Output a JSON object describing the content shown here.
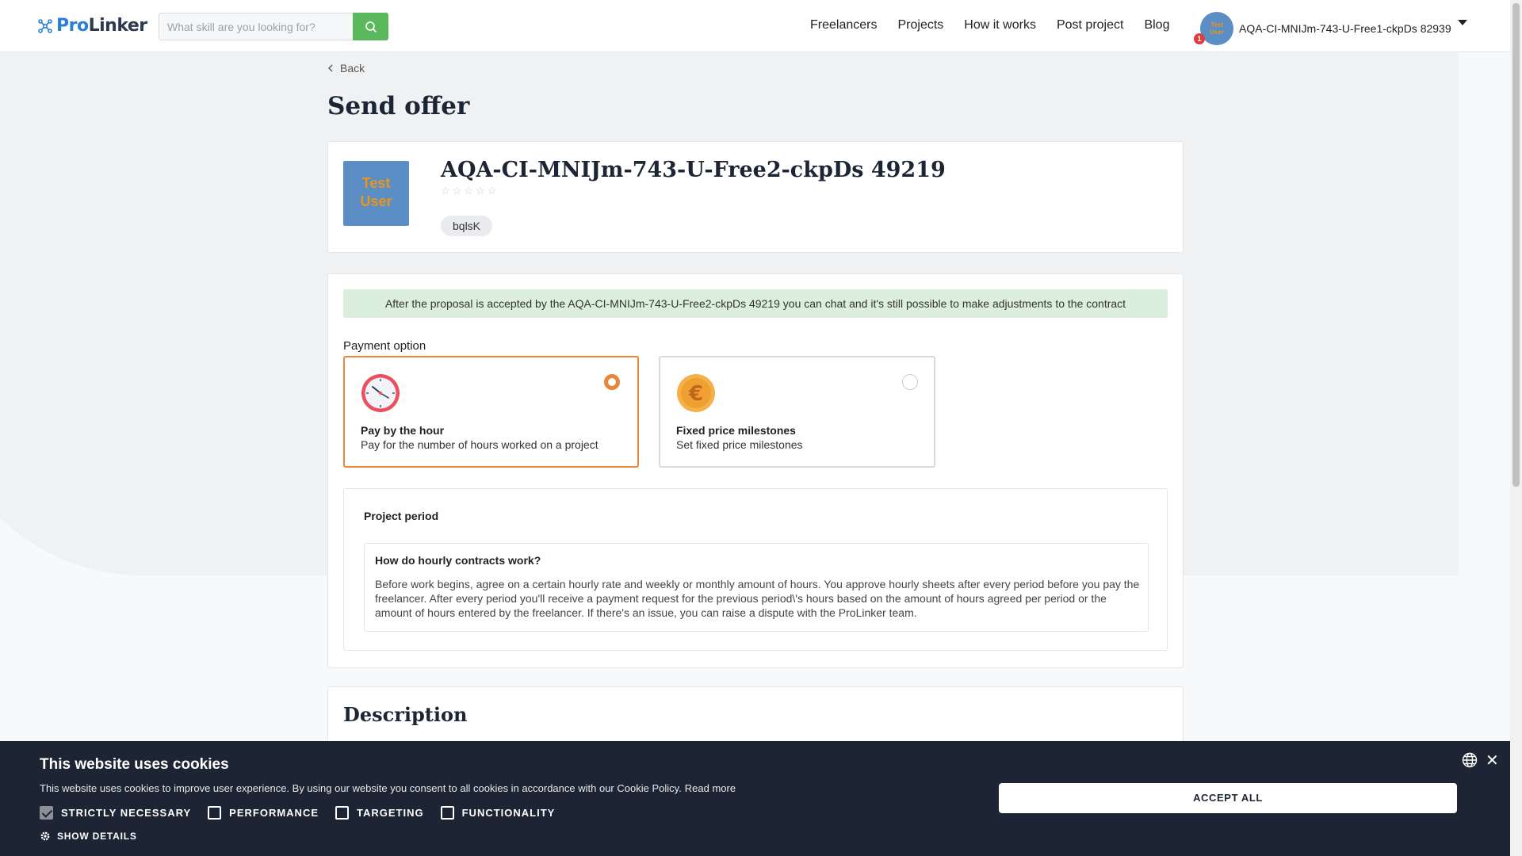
{
  "header": {
    "logo_pro": "Pro",
    "logo_linker": "Linker",
    "search_placeholder": "What skill are you looking for?",
    "nav": [
      "Freelancers",
      "Projects",
      "How it works",
      "Post project",
      "Blog"
    ],
    "user_avatar_text": "Test User",
    "notification_count": "1",
    "user_name": "AQA-CI-MNIJm-743-U-Free1-ckpDs 82939"
  },
  "page": {
    "back_label": "Back",
    "title": "Send offer"
  },
  "profile": {
    "photo_text_line1": "Test",
    "photo_text_line2": "User",
    "name": "AQA-CI-MNIJm-743-U-Free2-ckpDs 49219",
    "rating": 0,
    "tag": "bqlsK"
  },
  "offer": {
    "info_banner": "After the proposal is accepted by the AQA-CI-MNIJm-743-U-Free2-ckpDs 49219 you can chat and it's still possible to make adjustments to the contract",
    "payment_label": "Payment option",
    "options": [
      {
        "title": "Pay by the hour",
        "desc": "Pay for the number of hours worked on a project",
        "selected": true
      },
      {
        "title": "Fixed price milestones",
        "desc": "Set fixed price milestones",
        "selected": false
      }
    ],
    "period_title": "Project period",
    "hint_title": "How do hourly contracts work?",
    "hint_text": "Before work begins, agree on a certain hourly rate and weekly or monthly amount of hours. You approve hourly sheets after every period before you pay the freelancer. After every period you'll receive a payment request for the previous period\\'s hours based on the amount of hours agreed per period or the amount of hours entered by the freelancer. If there's an issue, you can raise a dispute with the ProLinker team."
  },
  "description": {
    "title": "Description"
  },
  "cookie": {
    "title": "This website uses cookies",
    "text": "This website uses cookies to improve user experience. By using our website you consent to all cookies in accordance with our Cookie Policy.",
    "read_more": "Read more",
    "options": [
      {
        "label": "STRICTLY NECESSARY",
        "checked": true
      },
      {
        "label": "PERFORMANCE",
        "checked": false
      },
      {
        "label": "TARGETING",
        "checked": false
      },
      {
        "label": "FUNCTIONALITY",
        "checked": false
      }
    ],
    "show_details": "SHOW DETAILS",
    "accept_all": "ACCEPT ALL"
  },
  "colors": {
    "accent_orange": "#e8873a",
    "search_green": "#5cb85c",
    "banner_green": "#dcefdc",
    "cookie_bg": "#1d2433"
  }
}
